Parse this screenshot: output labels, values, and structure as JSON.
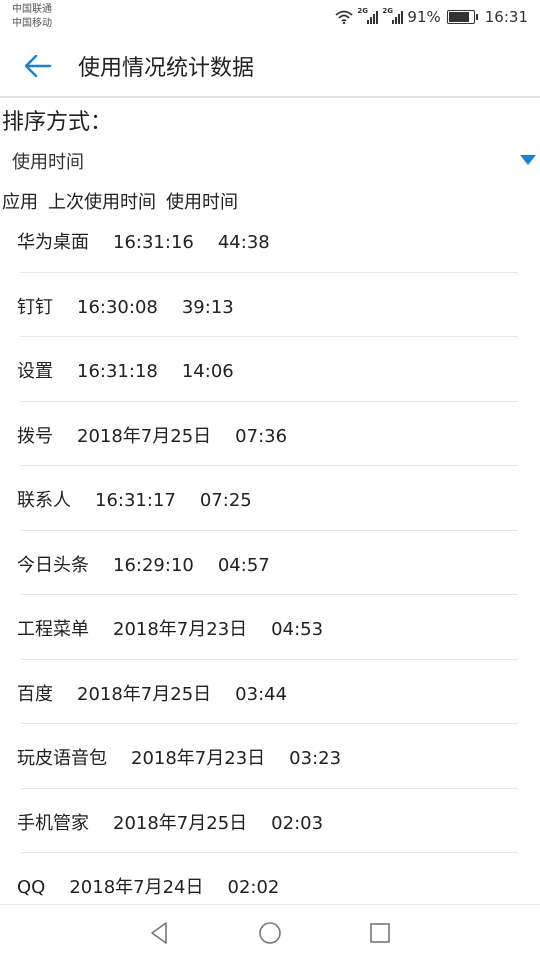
{
  "status_bar": {
    "carrier_1": "中国联通",
    "carrier_2": "中国移动",
    "sim1_tag": "2G",
    "sim2_tag": "2G",
    "battery_percent": "91%",
    "battery_level": 0.91,
    "time": "16:31"
  },
  "app_bar": {
    "title": "使用情况统计数据",
    "back_icon": "arrow-left-icon",
    "accent_color": "#1a82d6"
  },
  "sort": {
    "label": "排序方式：",
    "selected": "使用时间"
  },
  "columns": {
    "app": "应用",
    "last_used": "上次使用时间",
    "usage_time": "使用时间"
  },
  "rows": [
    {
      "app": "华为桌面",
      "last_used": "16:31:16",
      "usage_time": "44:38"
    },
    {
      "app": "钉钉",
      "last_used": "16:30:08",
      "usage_time": "39:13"
    },
    {
      "app": "设置",
      "last_used": "16:31:18",
      "usage_time": "14:06"
    },
    {
      "app": "拨号",
      "last_used": "2018年7月25日",
      "usage_time": "07:36"
    },
    {
      "app": "联系人",
      "last_used": "16:31:17",
      "usage_time": "07:25"
    },
    {
      "app": "今日头条",
      "last_used": "16:29:10",
      "usage_time": "04:57"
    },
    {
      "app": "工程菜单",
      "last_used": "2018年7月23日",
      "usage_time": "04:53"
    },
    {
      "app": "百度",
      "last_used": "2018年7月25日",
      "usage_time": "03:44"
    },
    {
      "app": "玩皮语音包",
      "last_used": "2018年7月23日",
      "usage_time": "03:23"
    },
    {
      "app": "手机管家",
      "last_used": "2018年7月25日",
      "usage_time": "02:03"
    },
    {
      "app": "QQ",
      "last_used": "2018年7月24日",
      "usage_time": "02:02"
    }
  ],
  "nav_bar": {
    "back_icon": "triangle-back-icon",
    "home_icon": "circle-home-icon",
    "recents_icon": "square-recents-icon"
  }
}
